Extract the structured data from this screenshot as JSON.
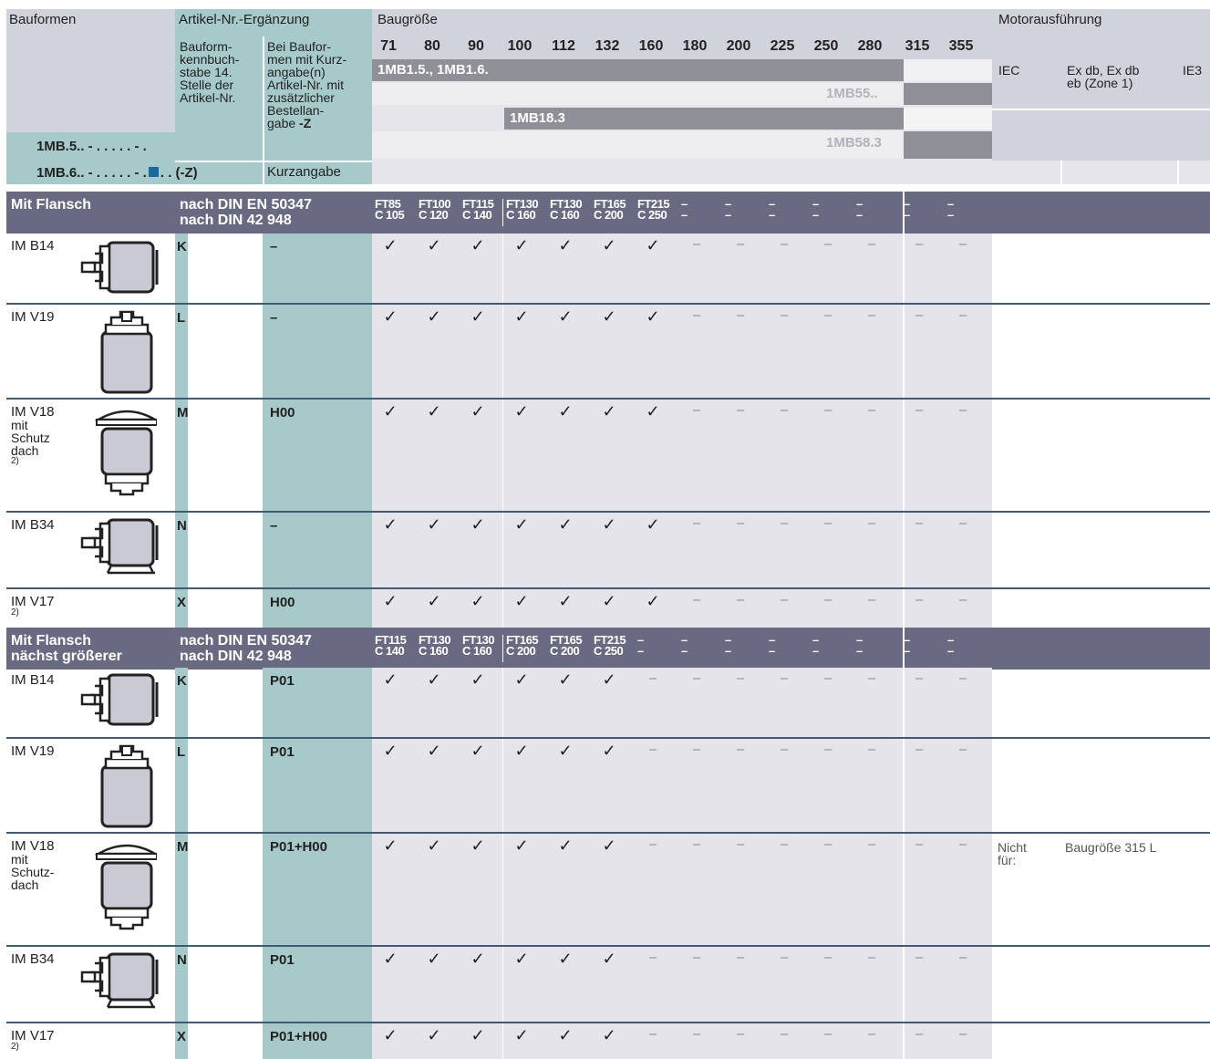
{
  "header": {
    "bauformen": "Bauformen",
    "artikel_ergaenzung": "Artikel-Nr.-Ergänzung",
    "bauform_kenn": [
      "Bauform-",
      "kennbuch-",
      "stabe 14.",
      "Stelle der",
      "Artikel-Nr."
    ],
    "bei_bauformen": [
      "Bei Baufor-",
      "men mit Kurz-",
      "angabe(n)",
      "Artikel-Nr. mit",
      "zusätzlicher",
      "Bestellan-",
      "gabe "
    ],
    "bei_bauformen_z": "-Z",
    "kurzangabe": "Kurzangabe",
    "code1": "1MB.5.. - . . . . . - .",
    "code2_a": "1MB.6.. - . . . . . - .",
    "code2_b": ". . (-Z)",
    "baugroesse": "Baugröße",
    "sizes": [
      "71",
      "80",
      "90",
      "100",
      "112",
      "132",
      "160",
      "180",
      "200",
      "225",
      "250",
      "280",
      "315",
      "355"
    ],
    "motorausfuehrung": "Motorausführung",
    "bar1": "1MB1.5., 1MB1.6.",
    "bar2": "1MB55..",
    "bar3": "1MB18.3",
    "bar4": "1MB58.3",
    "iec": "IEC",
    "exdb": [
      "Ex db, Ex db",
      "eb (Zone 1)"
    ],
    "ie3": "IE3"
  },
  "sections": [
    {
      "title": [
        "Mit Flansch",
        ""
      ],
      "norm": [
        "nach DIN EN 50347",
        "nach DIN 42 948"
      ],
      "ft": [
        [
          "FT85",
          "C 105"
        ],
        [
          "FT100",
          "C 120"
        ],
        [
          "FT115",
          "C 140"
        ],
        [
          "FT130",
          "C 160"
        ],
        [
          "FT130",
          "C 160"
        ],
        [
          "FT165",
          "C 200"
        ],
        [
          "FT215",
          "C 250"
        ],
        [
          "–",
          "–"
        ],
        [
          "–",
          "–"
        ],
        [
          "–",
          "–"
        ],
        [
          "–",
          "–"
        ],
        [
          "–",
          "–"
        ],
        [
          "–",
          "–"
        ],
        [
          "–",
          "–"
        ]
      ],
      "rows": [
        {
          "name": [
            "IM B14"
          ],
          "letter": "K",
          "kurz": "–",
          "marks": [
            "✓",
            "✓",
            "✓",
            "✓",
            "✓",
            "✓",
            "✓",
            "–",
            "–",
            "–",
            "–",
            "–",
            "–",
            "–"
          ]
        },
        {
          "name": [
            "IM V19"
          ],
          "letter": "L",
          "kurz": "–",
          "marks": [
            "✓",
            "✓",
            "✓",
            "✓",
            "✓",
            "✓",
            "✓",
            "–",
            "–",
            "–",
            "–",
            "–",
            "–",
            "–"
          ]
        },
        {
          "name": [
            "IM V18",
            "mit",
            "Schutz",
            "dach",
            "2)"
          ],
          "letter": "M",
          "kurz": "H00",
          "marks": [
            "✓",
            "✓",
            "✓",
            "✓",
            "✓",
            "✓",
            "✓",
            "–",
            "–",
            "–",
            "–",
            "–",
            "–",
            "–"
          ]
        },
        {
          "name": [
            "IM B34"
          ],
          "letter": "N",
          "kurz": "–",
          "marks": [
            "✓",
            "✓",
            "✓",
            "✓",
            "✓",
            "✓",
            "✓",
            "–",
            "–",
            "–",
            "–",
            "–",
            "–",
            "–"
          ]
        },
        {
          "name": [
            "IM V17",
            "2)"
          ],
          "letter": "X",
          "kurz": "H00",
          "marks": [
            "✓",
            "✓",
            "✓",
            "✓",
            "✓",
            "✓",
            "✓",
            "–",
            "–",
            "–",
            "–",
            "–",
            "–",
            "–"
          ]
        }
      ]
    },
    {
      "title": [
        "Mit Flansch",
        "nächst größerer"
      ],
      "norm": [
        "nach DIN EN 50347",
        "nach DIN 42 948"
      ],
      "ft": [
        [
          "FT115",
          "C 140"
        ],
        [
          "FT130",
          "C 160"
        ],
        [
          "FT130",
          "C 160"
        ],
        [
          "FT165",
          "C 200"
        ],
        [
          "FT165",
          "C 200"
        ],
        [
          "FT215",
          "C 250"
        ],
        [
          "–",
          "–"
        ],
        [
          "–",
          "–"
        ],
        [
          "–",
          "–"
        ],
        [
          "–",
          "–"
        ],
        [
          "–",
          "–"
        ],
        [
          "–",
          "–"
        ],
        [
          "–",
          "–"
        ],
        [
          "–",
          "–"
        ]
      ],
      "rows": [
        {
          "name": [
            "IM B14"
          ],
          "letter": "K",
          "kurz": "P01",
          "marks": [
            "✓",
            "✓",
            "✓",
            "✓",
            "✓",
            "✓",
            "–",
            "–",
            "–",
            "–",
            "–",
            "–",
            "–",
            "–"
          ]
        },
        {
          "name": [
            "IM V19"
          ],
          "letter": "L",
          "kurz": "P01",
          "marks": [
            "✓",
            "✓",
            "✓",
            "✓",
            "✓",
            "✓",
            "–",
            "–",
            "–",
            "–",
            "–",
            "–",
            "–",
            "–"
          ]
        },
        {
          "name": [
            "IM V18",
            "mit",
            "Schutz-",
            "dach"
          ],
          "letter": "M",
          "kurz": "P01+H00",
          "marks": [
            "✓",
            "✓",
            "✓",
            "✓",
            "✓",
            "✓",
            "–",
            "–",
            "–",
            "–",
            "–",
            "–",
            "–",
            "–"
          ],
          "note": [
            "Nicht",
            "für:"
          ],
          "note2": "Baugröße 315 L"
        },
        {
          "name": [
            "IM B34"
          ],
          "letter": "N",
          "kurz": "P01",
          "marks": [
            "✓",
            "✓",
            "✓",
            "✓",
            "✓",
            "✓",
            "–",
            "–",
            "–",
            "–",
            "–",
            "–",
            "–",
            "–"
          ]
        },
        {
          "name": [
            "IM V17",
            "2)"
          ],
          "letter": "X",
          "kurz": "P01+H00",
          "marks": [
            "✓",
            "✓",
            "✓",
            "✓",
            "✓",
            "✓",
            "–",
            "–",
            "–",
            "–",
            "–",
            "–",
            "–",
            "–"
          ]
        }
      ]
    }
  ]
}
